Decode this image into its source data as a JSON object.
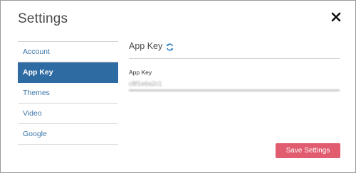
{
  "dialog": {
    "title": "Settings",
    "close_icon": "close-icon"
  },
  "sidebar": {
    "items": [
      {
        "label": "Account",
        "active": false
      },
      {
        "label": "App Key",
        "active": true
      },
      {
        "label": "Themes",
        "active": false
      },
      {
        "label": "Video",
        "active": false
      },
      {
        "label": "Google",
        "active": false
      }
    ]
  },
  "panel": {
    "title": "App Key",
    "refresh_icon": "refresh-icon",
    "field_label": "App Key",
    "field_value": "c8f1e6a2c1"
  },
  "footer": {
    "save_label": "Save Settings"
  },
  "colors": {
    "accent": "#2f6ba3",
    "link": "#3a76a8",
    "save_button": "#e05c6e"
  }
}
